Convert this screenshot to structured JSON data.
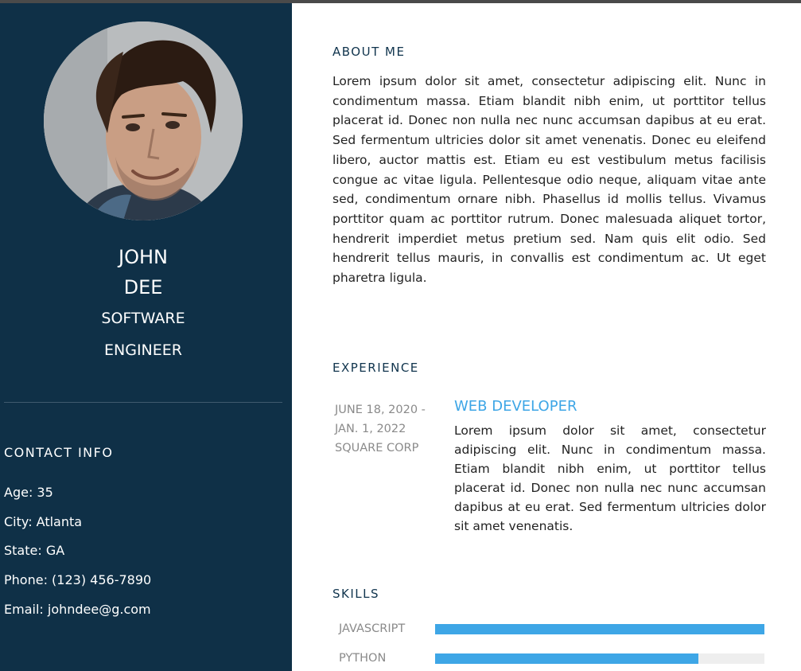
{
  "profile": {
    "first_name": "JOHN",
    "last_name": "DEE",
    "role_line1": "SOFTWARE",
    "role_line2": "ENGINEER"
  },
  "contact": {
    "heading": "CONTACT INFO",
    "items": [
      "Age: 35",
      "City: Atlanta",
      "State: GA",
      "Phone: (123) 456-7890",
      "Email: johndee@g.com"
    ]
  },
  "about": {
    "heading": "ABOUT ME",
    "text": "Lorem ipsum dolor sit amet, consectetur adipiscing elit. Nunc in condimentum massa. Etiam blandit nibh enim, ut porttitor tellus placerat id. Donec non nulla nec nunc accumsan dapibus at eu erat. Sed fermentum ultricies dolor sit amet venenatis. Donec eu eleifend libero, auctor mattis est. Etiam eu est vestibulum metus facilisis congue ac vitae ligula. Pellentesque odio neque, aliquam vitae ante sed, condimentum ornare nibh. Phasellus id mollis tellus. Vivamus porttitor quam ac porttitor rutrum. Donec malesuada aliquet tortor, hendrerit imperdiet metus pretium sed. Nam quis elit odio. Sed hendrerit tellus mauris, in convallis est condimentum ac. Ut eget pharetra ligula."
  },
  "experience": {
    "heading": "EXPERIENCE",
    "items": [
      {
        "date_line1": "JUNE 18, 2020 -",
        "date_line2": "JAN. 1, 2022",
        "company": "SQUARE CORP",
        "title": "WEB DEVELOPER",
        "description": "Lorem ipsum dolor sit amet, consectetur adipiscing elit. Nunc in condimentum massa. Etiam blandit nibh enim, ut porttitor tellus placerat id. Donec non nulla nec nunc accumsan dapibus at eu erat. Sed fermentum ultricies dolor sit amet venenatis."
      }
    ]
  },
  "skills": {
    "heading": "SKILLS",
    "items": [
      {
        "name": "JAVASCRIPT",
        "level": 1.0
      },
      {
        "name": "PYTHON",
        "level": 0.8
      }
    ]
  },
  "colors": {
    "sidebar_bg": "#0f3047",
    "accent": "#3ea6e6",
    "heading": "#10344d"
  },
  "icons": {
    "avatar": "profile-photo"
  }
}
